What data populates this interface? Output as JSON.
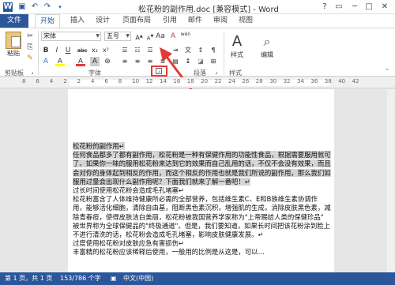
{
  "window": {
    "title": "松花粉的副作用.doc [兼容模式] - Word",
    "controls": [
      "?",
      "▭",
      "─",
      "□",
      "✕"
    ]
  },
  "quick_access": {
    "icons": [
      "word-logo-icon",
      "save-icon",
      "undo-icon",
      "redo-icon"
    ]
  },
  "tabs": [
    "文件",
    "开始",
    "插入",
    "设计",
    "页面布局",
    "引用",
    "邮件",
    "审阅",
    "视图"
  ],
  "ribbon": {
    "clipboard": {
      "paste_label": "粘贴",
      "group_label": "剪贴板"
    },
    "font": {
      "font_name": "宋体",
      "font_size": "五号",
      "wen": "wén",
      "group_label": "字体",
      "row2": [
        "B",
        "I",
        "U",
        "abc",
        "x₂",
        "x²"
      ],
      "row3": [
        "A",
        "A",
        "Aa",
        "A",
        "A",
        "⊛"
      ]
    },
    "paragraph": {
      "group_label": "段落"
    },
    "styles": {
      "label": "样式",
      "group_label": "样式"
    },
    "editing": {
      "label": "编辑"
    }
  },
  "accent": {
    "word_blue": "#2b579a",
    "highlight_red": "#e53935"
  },
  "ruler": {
    "marks": [
      "8",
      "6",
      "4",
      "2",
      "2",
      "4",
      "6",
      "8",
      "10",
      "12",
      "14",
      "16",
      "18",
      "20",
      "22",
      "24",
      "26",
      "28",
      "30",
      "32",
      "34",
      "36",
      "38",
      "40",
      "42"
    ]
  },
  "document": {
    "lines": [
      {
        "text": "松花粉的副作用↵",
        "hl": true
      },
      {
        "text": "任何食品都多了都有副作用，松花粉是一种有保健作用的功能性食品，根据需要服用就可以",
        "hl": true
      },
      {
        "text": "了。如果你一味的服用松花粉来达到它的效果而自己乱用的话，不仅不会没有效果，而且还",
        "hl": true
      },
      {
        "text": "会对你的身体起到相反的作用，而这个相反的作用也就是我们所说的副作用，那么我们如果",
        "hl": true
      },
      {
        "text": "服用过量会出现什么副作用呢？下面我们就来了解一番吧！↵",
        "hl": true
      },
      {
        "text": "过长时间使用松花粉会造成毛孔堵塞↵",
        "hl": false
      },
      {
        "text": "松花粉富含了人体维持健康所必需的全部营养，包括维生素C、E和B族维生素协调作",
        "hl": false
      },
      {
        "text": "用，能够活化细胞，清除自由基，阻断黑色素沉积，增强肌的生成，消除皮肤黑色素，减少、去",
        "hl": false
      },
      {
        "text": "除青春痘，使得皮肤洁白美丽，松花粉被我国营养学家称为\"上帝赐给人类的保健珍品\"",
        "hl": false
      },
      {
        "text": "被世界称为全球保健品的\"终极通道\"。但是，我们要知道，如果长时间把该花粉涂到脸上，",
        "hl": false
      },
      {
        "text": "不进行清洗的话，松花粉会造成毛孔堵塞，影响皮肤健康发展。↵",
        "hl": false
      },
      {
        "text": "过度使用松花粉对皮肤应急有害损伤↵",
        "hl": false
      },
      {
        "text": "丰富精的松花粉应该稀释后使用，一般用的比例是从这是，可以…",
        "hl": false
      }
    ]
  },
  "status": {
    "page": "第 1 页，共 1 页",
    "words": "153/786 个字",
    "lang": "中文(中国)"
  }
}
